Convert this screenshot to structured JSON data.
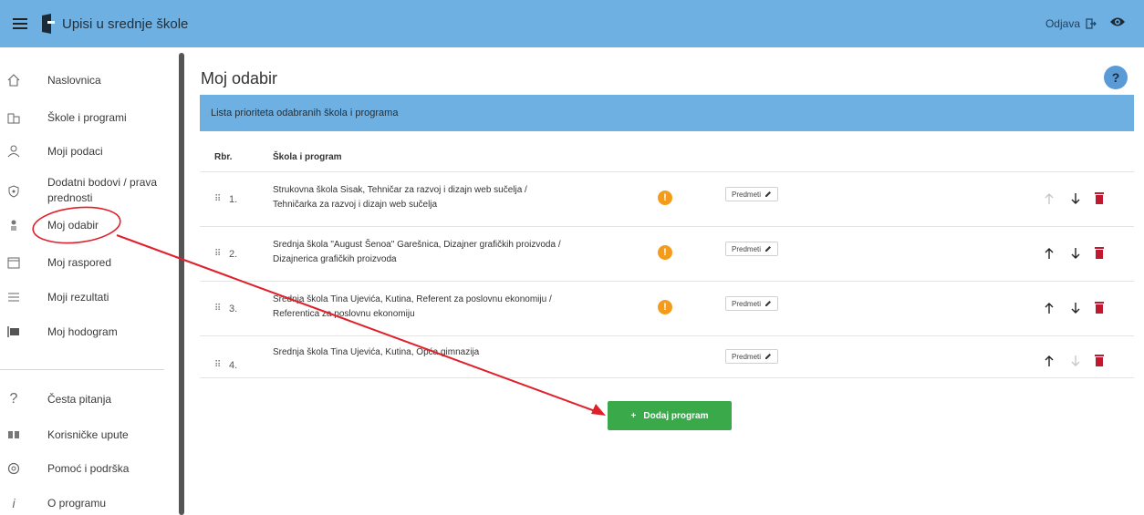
{
  "header": {
    "app_title": "Upisi u srednje škole",
    "logout_label": "Odjava",
    "colors": {
      "bar": "#6fb0e2",
      "accent_green": "#3aa94a",
      "delete_red": "#c0182e",
      "warning": "#f39c1b",
      "annotation_red": "#e0202a"
    }
  },
  "sidebar": {
    "items": [
      {
        "label": "Naslovnica",
        "icon": "home-icon"
      },
      {
        "label": "Škole i programi",
        "icon": "building-icon"
      },
      {
        "label": "Moji podaci",
        "icon": "person-icon"
      },
      {
        "label": "Dodatni bodovi / prava prednosti",
        "icon": "shield-icon"
      },
      {
        "label": "Moj odabir",
        "icon": "user-choice-icon"
      },
      {
        "label": "Moj raspored",
        "icon": "calendar-icon"
      },
      {
        "label": "Moji rezultati",
        "icon": "list-icon"
      },
      {
        "label": "Moj hodogram",
        "icon": "timeline-icon"
      }
    ],
    "secondary": [
      {
        "label": "Česta pitanja",
        "icon": "question-icon"
      },
      {
        "label": "Korisničke upute",
        "icon": "book-icon"
      },
      {
        "label": "Pomoć i podrška",
        "icon": "support-icon"
      },
      {
        "label": "O programu",
        "icon": "info-icon"
      }
    ]
  },
  "main": {
    "title": "Moj odabir",
    "help_label": "?",
    "card_title": "Lista prioriteta odabranih škola i programa",
    "columns": {
      "rank": "Rbr.",
      "program": "Škola i program"
    },
    "rows": [
      {
        "rank": "1.",
        "line1": "Strukovna škola Sisak, Tehničar za razvoj i dizajn web sučelja /",
        "line2": "Tehničarka za razvoj i dizajn web sučelja",
        "subjects": "Predmeti",
        "warning": "!"
      },
      {
        "rank": "2.",
        "line1": "Srednja škola \"August Šenoa\" Garešnica, Dizajner grafičkih proizvoda /",
        "line2": "Dizajnerica grafičkih proizvoda",
        "subjects": "Predmeti",
        "warning": "!"
      },
      {
        "rank": "3.",
        "line1": "Srednja škola Tina Ujevića, Kutina, Referent za poslovnu ekonomiju /",
        "line2": "Referentica za poslovnu ekonomiju",
        "subjects": "Predmeti",
        "warning": "!"
      },
      {
        "rank": "4.",
        "line1": "Srednja škola Tina Ujevića, Kutina, Opća gimnazija",
        "line2": "",
        "subjects": "Predmeti",
        "warning": ""
      }
    ],
    "add_button": "Dodaj program",
    "add_icon": "+"
  }
}
